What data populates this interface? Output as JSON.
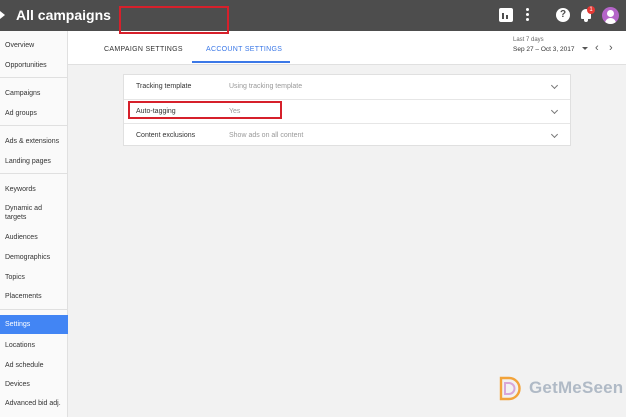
{
  "topbar": {
    "title": "All campaigns",
    "icons": [
      "reports-icon",
      "more-vert-icon",
      "help-icon",
      "notifications-icon",
      "account-avatar"
    ],
    "notification_count": "1"
  },
  "sidebar": {
    "items": [
      {
        "label": "Overview"
      },
      {
        "label": "Opportunities"
      },
      {
        "label": "Campaigns"
      },
      {
        "label": "Ad groups"
      },
      {
        "label": "Ads & extensions"
      },
      {
        "label": "Landing pages"
      },
      {
        "label": "Keywords"
      },
      {
        "label": "Dynamic ad targets"
      },
      {
        "label": "Audiences"
      },
      {
        "label": "Demographics"
      },
      {
        "label": "Topics"
      },
      {
        "label": "Placements"
      },
      {
        "label": "Settings"
      },
      {
        "label": "Locations"
      },
      {
        "label": "Ad schedule"
      },
      {
        "label": "Devices"
      },
      {
        "label": "Advanced bid adj."
      }
    ],
    "active_item": "Settings"
  },
  "tabs": {
    "campaign_settings": "CAMPAIGN SETTINGS",
    "account_settings": "ACCOUNT SETTINGS",
    "active": "ACCOUNT SETTINGS"
  },
  "date_range": {
    "label": "Last 7 days",
    "value": "Sep 27 – Oct 3, 2017"
  },
  "settings": {
    "rows": [
      {
        "label": "Tracking template",
        "value": "Using tracking template"
      },
      {
        "label": "Auto-tagging",
        "value": "Yes"
      },
      {
        "label": "Content exclusions",
        "value": "Show ads on all content"
      }
    ]
  },
  "watermark": {
    "brand": "GetMeSeen"
  },
  "colors": {
    "topbar": "#4d4d4d",
    "accent": "#3b78e7",
    "sidebar_active": "#4285f4",
    "highlight": "#d6202b",
    "avatar": "#b565c9",
    "badge": "#e53935"
  }
}
